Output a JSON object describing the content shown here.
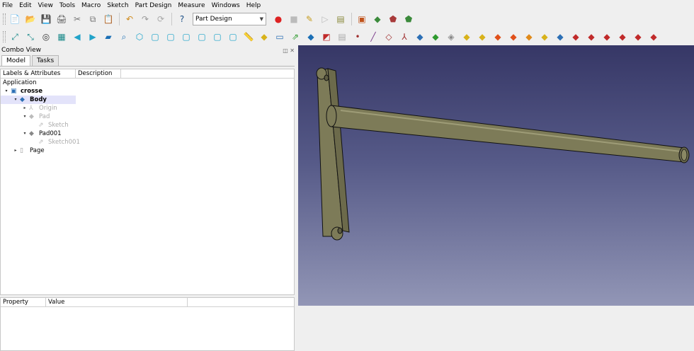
{
  "menu": [
    "File",
    "Edit",
    "View",
    "Tools",
    "Macro",
    "Sketch",
    "Part Design",
    "Measure",
    "Windows",
    "Help"
  ],
  "toolbar1": {
    "workbench": "Part Design",
    "icons": [
      "new-icon",
      "open-icon",
      "save-icon",
      "print-icon",
      "cut-icon",
      "copy-icon",
      "paste-icon",
      "undo-icon",
      "redo-icon",
      "refresh-icon",
      "whats-this-icon",
      "record-macro-icon",
      "stop-macro-icon",
      "edit-macro-icon",
      "run-macro-icon",
      "macros-icon",
      "part-icon",
      "group-icon",
      "link-icon",
      "link-sub-icon"
    ]
  },
  "toolbar2": {
    "icons": [
      "fit-all-icon",
      "fit-selection-icon",
      "draw-style-icon",
      "bounding-box-icon",
      "back-icon",
      "forward-icon",
      "workbench-icon",
      "sync-view-icon",
      "isometric-icon",
      "front-icon",
      "top-icon",
      "right-icon",
      "rear-icon",
      "bottom-icon",
      "left-icon",
      "measure-icon",
      "body-icon",
      "folder-icon",
      "sketch-icon",
      "new-body-icon",
      "clone-icon",
      "shape-binder-icon",
      "datum-point-icon",
      "datum-line-icon",
      "datum-plane-icon",
      "lcs-icon",
      "pad-icon",
      "pocket-icon",
      "revolution-icon",
      "loft-icon",
      "pipe-icon",
      "additive-box-icon",
      "subtractive-box-icon",
      "groove-icon",
      "hole-icon",
      "fillet-icon",
      "chamfer-icon",
      "draft-icon",
      "thickness-icon",
      "mirror-icon",
      "pattern-icon",
      "boolean-icon"
    ]
  },
  "combo": {
    "title": "Combo View",
    "tabs": [
      "Model",
      "Tasks"
    ],
    "tree_headers": [
      "Labels & Attributes",
      "Description"
    ],
    "section": "Application",
    "tree": [
      {
        "label": "crosse",
        "depth": 0,
        "expander": "▾",
        "style": "bold",
        "icon": "document-icon"
      },
      {
        "label": "Body",
        "depth": 1,
        "expander": "▾",
        "style": "bold sel",
        "icon": "body-icon"
      },
      {
        "label": "Origin",
        "depth": 2,
        "expander": "▸",
        "style": "dim",
        "icon": "origin-icon"
      },
      {
        "label": "Pad",
        "depth": 2,
        "expander": "▾",
        "style": "dim",
        "icon": "pad-icon"
      },
      {
        "label": "Sketch",
        "depth": 3,
        "expander": "",
        "style": "dim",
        "icon": "sketch-icon"
      },
      {
        "label": "Pad001",
        "depth": 2,
        "expander": "▾",
        "style": "",
        "icon": "pad-icon"
      },
      {
        "label": "Sketch001",
        "depth": 3,
        "expander": "",
        "style": "dim",
        "icon": "sketch-icon"
      },
      {
        "label": "Page",
        "depth": 1,
        "expander": "▸",
        "style": "",
        "icon": "page-icon"
      }
    ],
    "prop_headers": [
      "Property",
      "Value"
    ]
  },
  "colors": {
    "viewport_top": "#363766",
    "viewport_bottom": "#9296b6",
    "model_fill": "#7d7b58",
    "model_edge": "#111111"
  }
}
